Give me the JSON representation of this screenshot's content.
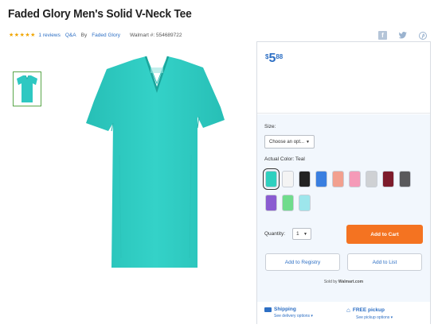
{
  "product": {
    "title": "Faded Glory Men's Solid V-Neck Tee",
    "reviews_label": "1 reviews",
    "qa_label": "Q&A",
    "by_prefix": "By",
    "brand": "Faded Glory",
    "walmart_number": "Walmart #: 554689722",
    "rating": 5
  },
  "price": {
    "currency": "$",
    "dollars": "5",
    "cents": "88"
  },
  "options": {
    "size_label": "Size:",
    "size_placeholder": "Choose an opt...",
    "color_label": "Actual Color:",
    "color_value": "Teal",
    "swatches": [
      "#2fd0bf",
      "#f4f4f4",
      "#222222",
      "#3a7fe0",
      "#f2a08f",
      "#f59ab8",
      "#cfd1d4",
      "#7d1b2b",
      "#59595c",
      "#8a5bd1",
      "#6fdc8c",
      "#9de6ec"
    ]
  },
  "purchase": {
    "quantity_label": "Quantity:",
    "quantity_value": "1",
    "add_to_cart": "Add to Cart",
    "add_to_registry": "Add to Registry",
    "add_to_list": "Add to List",
    "sold_by_prefix": "Sold by",
    "sold_by": "Walmart.com"
  },
  "fulfillment": {
    "shipping_label": "Shipping",
    "shipping_sub": "See delivery options",
    "pickup_label": "FREE pickup",
    "pickup_sub": "See pickup options"
  },
  "colors": {
    "link": "#2d6fc4",
    "cta": "#f47321",
    "shirt": "#2ec8c2"
  }
}
